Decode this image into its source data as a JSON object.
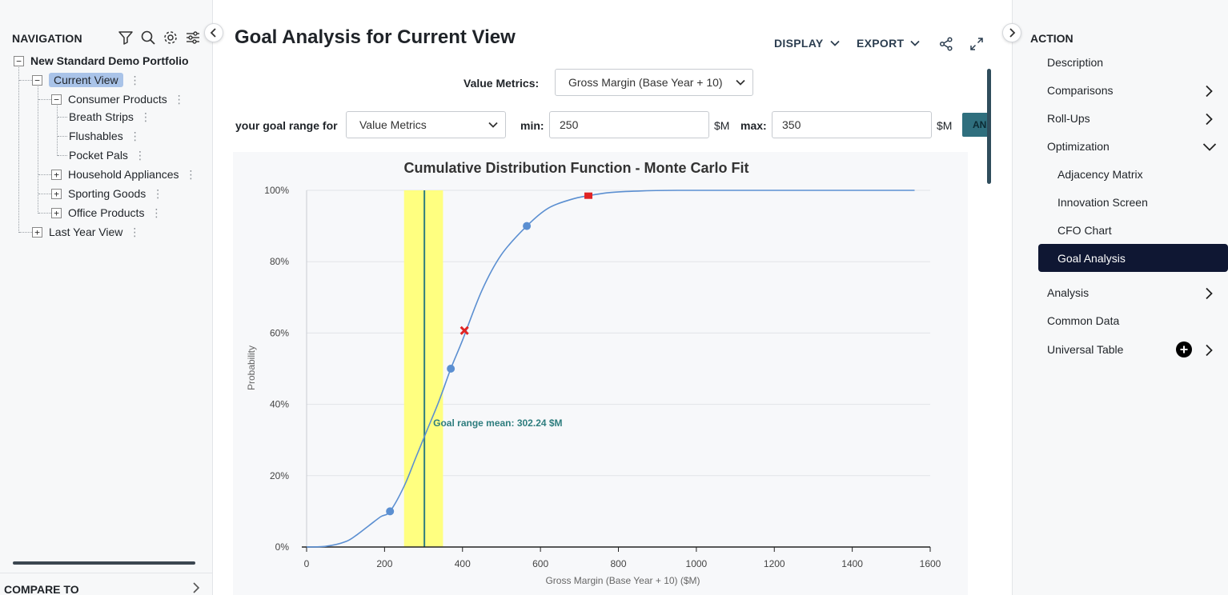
{
  "navigation": {
    "title": "NAVIGATION",
    "tools": [
      "filter-icon",
      "search-icon",
      "gear-icon",
      "sliders-icon"
    ],
    "tree": {
      "root": "New Standard Demo Portfolio",
      "current_view": "Current View",
      "consumer_products": "Consumer Products",
      "breath_strips": "Breath Strips",
      "flushables": "Flushables",
      "pocket_pals": "Pocket Pals",
      "household_appliances": "Household Appliances",
      "sporting_goods": "Sporting Goods",
      "office_products": "Office Products",
      "last_year_view": "Last Year View"
    },
    "compare_to": "COMPARE TO"
  },
  "main": {
    "title": "Goal Analysis for Current View",
    "display_label": "DISPLAY",
    "export_label": "EXPORT",
    "value_metrics_label": "Value Metrics:",
    "value_metrics_selected": "Gross Margin (Base Year + 10)",
    "goal_range_label": "your goal range for",
    "goal_range_selected": "Value Metrics",
    "min_label": "min:",
    "min_value": "250",
    "max_label": "max:",
    "max_value": "350",
    "unit": "$M",
    "apply_label": "AN"
  },
  "chart_data": {
    "type": "line",
    "title": "Cumulative Distribution Function - Monte Carlo Fit",
    "xlabel": "Gross Margin (Base Year + 10) ($M)",
    "ylabel": "Probability",
    "xlim": [
      0,
      1600
    ],
    "ylim": [
      0,
      1
    ],
    "x_ticks": [
      0,
      200,
      400,
      600,
      800,
      1000,
      1200,
      1400,
      1600
    ],
    "y_ticks": [
      0,
      0.2,
      0.4,
      0.6,
      0.8,
      1.0
    ],
    "y_tick_labels": [
      "0%",
      "20%",
      "40%",
      "60%",
      "80%",
      "100%"
    ],
    "curve": {
      "x": [
        0,
        50,
        100,
        130,
        160,
        190,
        214,
        250,
        280,
        310,
        340,
        370,
        400,
        450,
        500,
        565,
        620,
        680,
        723,
        780,
        850,
        950,
        1100,
        1300,
        1560
      ],
      "y": [
        0,
        0.002,
        0.015,
        0.035,
        0.06,
        0.085,
        0.1,
        0.17,
        0.25,
        0.33,
        0.41,
        0.5,
        0.58,
        0.72,
        0.82,
        0.9,
        0.95,
        0.975,
        0.985,
        0.994,
        0.998,
        1.0,
        1.0,
        1.0,
        1.0
      ]
    },
    "percentile_points": [
      {
        "x": 214,
        "y": 0.1
      },
      {
        "x": 370,
        "y": 0.5
      },
      {
        "x": 565,
        "y": 0.9
      }
    ],
    "x_marker": {
      "x": 405,
      "y": 0.607,
      "color": "#e02424"
    },
    "square_marker": {
      "x": 723,
      "y": 0.985,
      "color": "#e02424"
    },
    "goal_range": {
      "min": 250,
      "max": 350,
      "color": "#ffff80"
    },
    "goal_mean": {
      "x": 302.24,
      "label": "Goal range mean: 302.24 $M",
      "color": "#2e7d7e"
    },
    "line_color": "#5b8fd1",
    "grid": true
  },
  "action": {
    "title": "ACTION",
    "items": {
      "description": "Description",
      "comparisons": "Comparisons",
      "rollups": "Roll-Ups",
      "optimization": "Optimization",
      "adjacency": "Adjacency Matrix",
      "innovation": "Innovation Screen",
      "cfo": "CFO Chart",
      "goal": "Goal Analysis",
      "analysis": "Analysis",
      "common": "Common Data",
      "universal": "Universal Table"
    }
  }
}
